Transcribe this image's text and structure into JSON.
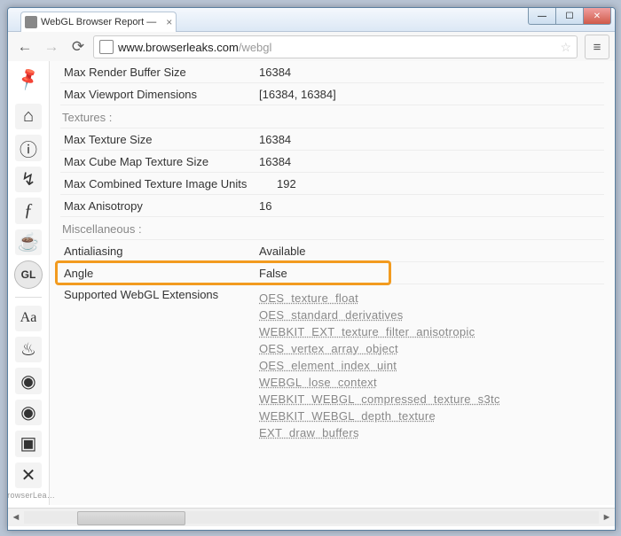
{
  "tab_title": "WebGL Browser Report — ",
  "url_host": "www.browserleaks.com",
  "url_path": "/webgl",
  "brand_label": "BrowserLea…",
  "sections": {
    "textures": "Textures :",
    "misc": "Miscellaneous :"
  },
  "rows": {
    "max_render_buffer": {
      "k": "Max Render Buffer Size",
      "v": "16384"
    },
    "max_viewport": {
      "k": "Max Viewport Dimensions",
      "v": "[16384, 16384]"
    },
    "max_texture": {
      "k": "Max Texture Size",
      "v": "16384"
    },
    "max_cube": {
      "k": "Max Cube Map Texture Size",
      "v": "16384"
    },
    "max_combined": {
      "k": "Max Combined Texture Image Units",
      "v": "192"
    },
    "max_aniso": {
      "k": "Max Anisotropy",
      "v": "16"
    },
    "antialias": {
      "k": "Antialiasing",
      "v": "Available"
    },
    "angle": {
      "k": "Angle",
      "v": "False"
    },
    "extensions_label": "Supported WebGL Extensions"
  },
  "extensions": [
    "OES_texture_float",
    "OES_standard_derivatives",
    "WEBKIT_EXT_texture_filter_anisotropic",
    "OES_vertex_array_object",
    "OES_element_index_uint",
    "WEBGL_lose_context",
    "WEBKIT_WEBGL_compressed_texture_s3tc",
    "WEBKIT_WEBGL_depth_texture",
    "EXT_draw_buffers"
  ],
  "nav_icons": {
    "home": "⌂",
    "info": "ⓘ",
    "script": "↯",
    "flash": "⚡",
    "java": "☕",
    "gl": "GL",
    "font": "Aa",
    "fire": "♨",
    "geo": "◉",
    "eye": "👁",
    "img": "🖼",
    "tools": "✖"
  }
}
